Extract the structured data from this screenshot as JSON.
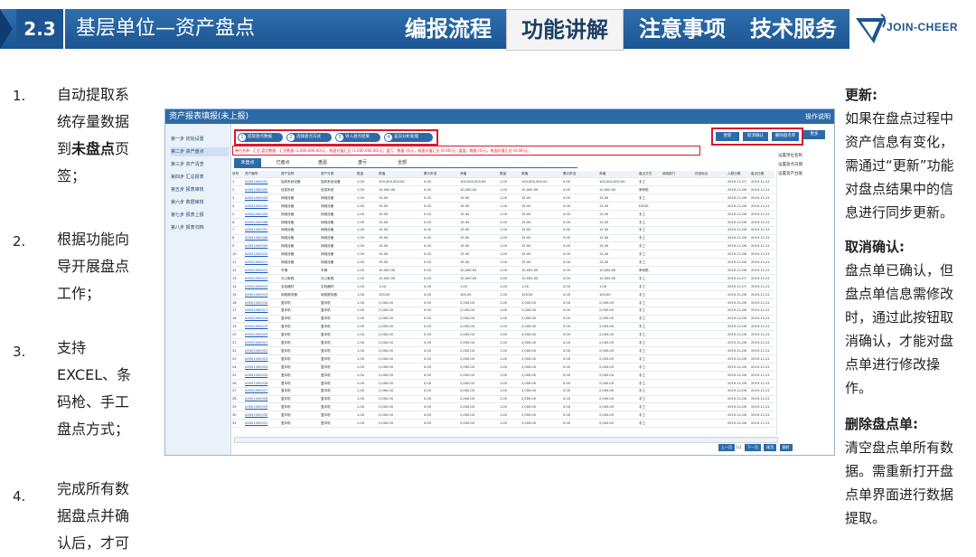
{
  "header": {
    "section_number": "2.3",
    "section_title": "基层单位—资产盘点",
    "nav": [
      "编报流程",
      "功能讲解",
      "注意事项",
      "技术服务"
    ],
    "active_nav": "功能讲解",
    "logo_text": "JOIN-CHEER"
  },
  "steps": [
    {
      "num": "1.",
      "lines": [
        "自动提取系",
        "统存量数据",
        "到|未盘点|页",
        "签；"
      ]
    },
    {
      "num": "2.",
      "lines": [
        "根据功能向",
        "导开展盘点",
        "工作；"
      ]
    },
    {
      "num": "3.",
      "lines": [
        "支持",
        "EXCEL、条",
        "码枪、手工",
        "盘点方式；"
      ]
    },
    {
      "num": "4.",
      "lines": [
        "完成所有数",
        "据盘点并确",
        "认后，才可"
      ]
    }
  ],
  "notes": [
    {
      "title": "更新:",
      "lines": [
        "如果在盘点过程中",
        "资产信息有变化，",
        "需通过“更新”功能",
        "对盘点结果中的信",
        "息进行同步更新。"
      ]
    },
    {
      "title": "取消确认:",
      "lines": [
        "盘点单已确认，但",
        "盘点单信息需修改",
        "时，通过此按钮取",
        "消确认，才能对盘",
        "点单进行修改操",
        "作。"
      ]
    },
    {
      "title": "删除盘点单:",
      "lines": [
        "清空盘点单所有数",
        "据。需重新打开盘",
        "点单界面进行数据",
        "提取。"
      ]
    }
  ],
  "screenshot": {
    "title": "资产报表填报(未上报)",
    "op_label": "操作说明",
    "sidebar": [
      "第一步 初始设置",
      "第二步 资产盘点",
      "第三步 资产清查",
      "第四步 汇总报表",
      "第五步 报表审核",
      "第六步 数据审核",
      "第七步 报表上报",
      "第八步 报表归档"
    ],
    "wizard": [
      "提取盘点数据",
      "选择盘点方式",
      "导入盘点结果",
      "差异分析处理"
    ],
    "buttons": [
      "更新",
      "取消确认",
      "删除盘点单"
    ],
    "more_label": "更多",
    "info_line": "单位名称：汇总 盘点数据：汇总数量 (1,000,000,00)元，账面价值汇总 (1,000,000,00)元；盘亏：数量 (0)元，账面价值汇总 (0.00)元；盘盈：数量 (0)元，账面价值汇总 (0.00)元；",
    "tabs": [
      "未盘点",
      "已盘点",
      "盘盈",
      "盘亏",
      "全部"
    ],
    "active_tab": "未盘点",
    "columns": [
      "序号",
      "资产编号",
      "资产名称",
      "资产分类",
      "数量",
      "原值",
      "累计折旧",
      "净值",
      "数量",
      "原值",
      "累计折旧",
      "净值",
      "盘点方式",
      "使用部门",
      "存放地点",
      "入账日期",
      "盘点日期"
    ],
    "rows": [
      [
        "1",
        "A0001000001",
        "抽风系统设备",
        "抽风系统设备",
        "1.00",
        "100,000,000.00",
        "0.00",
        "100,000,000.00",
        "1.00",
        "100,000,000.00",
        "0.00",
        "100,000,000.00",
        "手工",
        "",
        "",
        "2019-11-07",
        "2019-11-21"
      ],
      [
        "2",
        "A0001000002",
        "信息系统",
        "信息系统",
        "1.00",
        "10,000.00",
        "0.00",
        "10,000.00",
        "1.00",
        "10,000.00",
        "0.00",
        "10,000.00",
        "条码枪",
        "",
        "",
        "2019-11-06",
        "2019-11-21"
      ],
      [
        "3",
        "A0001000003",
        "网络设备",
        "网络设备",
        "1.00",
        "15.00",
        "0.00",
        "15.00",
        "1.00",
        "15.00",
        "0.00",
        "15.00",
        "手工",
        "",
        "",
        "2019-11-06",
        "2019-11-21"
      ],
      [
        "4",
        "A0001000004",
        "网络设备",
        "网络设备",
        "1.00",
        "15.00",
        "0.00",
        "15.00",
        "1.00",
        "15.00",
        "0.00",
        "15.00",
        "EXCEL",
        "",
        "",
        "2019-11-06",
        "2019-11-21"
      ],
      [
        "5",
        "A0001000005",
        "网络设备",
        "网络设备",
        "1.00",
        "15.00",
        "0.00",
        "15.00",
        "1.00",
        "15.00",
        "0.00",
        "15.00",
        "手工",
        "",
        "",
        "2019-11-06",
        "2019-11-21"
      ],
      [
        "6",
        "A0001000006",
        "网络设备",
        "网络设备",
        "1.00",
        "15.00",
        "0.00",
        "15.00",
        "1.00",
        "15.00",
        "0.00",
        "15.00",
        "手工",
        "",
        "",
        "2019-11-06",
        "2019-11-21"
      ],
      [
        "7",
        "A0001000007",
        "网络设备",
        "网络设备",
        "1.00",
        "15.00",
        "0.00",
        "15.00",
        "1.00",
        "15.00",
        "0.00",
        "15.00",
        "手工",
        "",
        "",
        "2019-11-06",
        "2019-11-21"
      ],
      [
        "8",
        "A0001000008",
        "网络设备",
        "网络设备",
        "1.00",
        "15.00",
        "0.00",
        "15.00",
        "1.00",
        "15.00",
        "0.00",
        "15.00",
        "手工",
        "",
        "",
        "2019-11-06",
        "2019-11-21"
      ],
      [
        "9",
        "A0001000009",
        "网络设备",
        "网络设备",
        "1.00",
        "15.00",
        "0.00",
        "15.00",
        "1.00",
        "15.00",
        "0.00",
        "15.00",
        "手工",
        "",
        "",
        "2019-11-06",
        "2019-11-21"
      ],
      [
        "10",
        "A0001000010",
        "网络设备",
        "网络设备",
        "1.00",
        "15.00",
        "0.00",
        "15.00",
        "1.00",
        "15.00",
        "0.00",
        "15.00",
        "手工",
        "",
        "",
        "2019-11-06",
        "2019-11-21"
      ],
      [
        "11",
        "A0001000011",
        "网络设备",
        "网络设备",
        "1.00",
        "15.00",
        "0.00",
        "15.00",
        "1.00",
        "15.00",
        "0.00",
        "15.00",
        "手工",
        "",
        "",
        "2019-11-06",
        "2019-11-21"
      ],
      [
        "12",
        "A0001000012",
        "车辆",
        "车辆",
        "1.00",
        "10,000.00",
        "0.00",
        "10,000.00",
        "1.00",
        "10,000.00",
        "0.00",
        "10,000.00",
        "条码枪",
        "",
        "",
        "2019-11-06",
        "2019-11-21"
      ],
      [
        "13",
        "A0001000013",
        "办公家具",
        "办公家具",
        "1.00",
        "10,000.00",
        "0.00",
        "10,000.00",
        "1.00",
        "10,000.00",
        "0.00",
        "10,000.00",
        "手工",
        "",
        "",
        "2019-11-07",
        "2019-11-21"
      ],
      [
        "14",
        "A0001000014",
        "实验器材",
        "实验器材",
        "1.00",
        "1.00",
        "0.00",
        "1.00",
        "1.00",
        "1.00",
        "0.00",
        "1.00",
        "手工",
        "",
        "",
        "2019-11-07",
        "2019-11-21"
      ],
      [
        "15",
        "A0001000015",
        "网络服务器",
        "网络服务器",
        "1.00",
        "100.00",
        "0.00",
        "100.00",
        "1.00",
        "100.00",
        "0.00",
        "100.00",
        "手工",
        "",
        "",
        "2019-11-06",
        "2019-11-21"
      ],
      [
        "16",
        "A0001000016",
        "复印机",
        "复印机",
        "1.00",
        "2,000.00",
        "0.00",
        "2,000.00",
        "1.00",
        "2,000.00",
        "0.00",
        "2,000.00",
        "手工",
        "",
        "",
        "2019-11-06",
        "2019-11-21"
      ],
      [
        "17",
        "A0001000017",
        "复印机",
        "复印机",
        "1.00",
        "2,000.00",
        "0.00",
        "2,000.00",
        "1.00",
        "2,000.00",
        "0.00",
        "2,000.00",
        "手工",
        "",
        "",
        "2019-11-06",
        "2019-11-21"
      ],
      [
        "18",
        "A0001000018",
        "复印机",
        "复印机",
        "1.00",
        "2,000.00",
        "0.00",
        "2,000.00",
        "1.00",
        "2,000.00",
        "0.00",
        "2,000.00",
        "手工",
        "",
        "",
        "2019-11-06",
        "2019-11-21"
      ],
      [
        "19",
        "A0001000019",
        "复印机",
        "复印机",
        "1.00",
        "2,000.00",
        "0.00",
        "2,000.00",
        "1.00",
        "2,000.00",
        "0.00",
        "2,000.00",
        "手工",
        "",
        "",
        "2019-11-06",
        "2019-11-21"
      ],
      [
        "20",
        "A0001000020",
        "复印机",
        "复印机",
        "1.00",
        "2,000.00",
        "0.00",
        "2,000.00",
        "1.00",
        "2,000.00",
        "0.00",
        "2,000.00",
        "手工",
        "",
        "",
        "2019-11-06",
        "2019-11-21"
      ],
      [
        "21",
        "A0001000021",
        "复印机",
        "复印机",
        "1.00",
        "2,000.00",
        "0.00",
        "2,000.00",
        "1.00",
        "2,000.00",
        "0.00",
        "2,000.00",
        "手工",
        "",
        "",
        "2019-11-06",
        "2019-11-21"
      ],
      [
        "22",
        "A0001000022",
        "复印机",
        "复印机",
        "1.00",
        "2,000.00",
        "0.00",
        "2,000.00",
        "1.00",
        "2,000.00",
        "0.00",
        "2,000.00",
        "手工",
        "",
        "",
        "2019-11-06",
        "2019-11-21"
      ],
      [
        "23",
        "A0001000023",
        "复印机",
        "复印机",
        "1.00",
        "2,000.00",
        "0.00",
        "2,000.00",
        "1.00",
        "2,000.00",
        "0.00",
        "2,000.00",
        "手工",
        "",
        "",
        "2019-11-06",
        "2019-11-21"
      ],
      [
        "24",
        "A0001000024",
        "复印机",
        "复印机",
        "1.00",
        "2,000.00",
        "0.00",
        "2,000.00",
        "1.00",
        "2,000.00",
        "0.00",
        "2,000.00",
        "手工",
        "",
        "",
        "2019-11-06",
        "2019-11-21"
      ],
      [
        "25",
        "A0001000025",
        "复印机",
        "复印机",
        "1.00",
        "2,000.00",
        "0.00",
        "2,000.00",
        "1.00",
        "2,000.00",
        "0.00",
        "2,000.00",
        "手工",
        "",
        "",
        "2019-11-06",
        "2019-11-21"
      ],
      [
        "26",
        "A0001000026",
        "复印机",
        "复印机",
        "1.00",
        "2,000.00",
        "0.00",
        "2,000.00",
        "1.00",
        "2,000.00",
        "0.00",
        "2,000.00",
        "手工",
        "",
        "",
        "2019-11-06",
        "2019-11-21"
      ],
      [
        "27",
        "A0001000027",
        "复印机",
        "复印机",
        "1.00",
        "2,000.00",
        "0.00",
        "2,000.00",
        "1.00",
        "2,000.00",
        "0.00",
        "2,000.00",
        "手工",
        "",
        "",
        "2019-11-06",
        "2019-11-21"
      ],
      [
        "28",
        "A0001000028",
        "复印机",
        "复印机",
        "1.00",
        "2,000.00",
        "0.00",
        "2,000.00",
        "1.00",
        "2,000.00",
        "0.00",
        "2,000.00",
        "手工",
        "",
        "",
        "2019-11-06",
        "2019-11-21"
      ],
      [
        "29",
        "A0001000029",
        "复印机",
        "复印机",
        "1.00",
        "2,000.00",
        "0.00",
        "2,000.00",
        "1.00",
        "2,000.00",
        "0.00",
        "2,000.00",
        "手工",
        "",
        "",
        "2019-11-06",
        "2019-11-21"
      ],
      [
        "30",
        "A0001000030",
        "复印机",
        "复印机",
        "1.00",
        "2,000.00",
        "0.00",
        "2,000.00",
        "1.00",
        "2,000.00",
        "0.00",
        "2,000.00",
        "手工",
        "",
        "",
        "2019-11-06",
        "2019-11-21"
      ],
      [
        "31",
        "A0001000031",
        "复印机",
        "复印机",
        "1.00",
        "2,000.00",
        "0.00",
        "2,000.00",
        "1.00",
        "2,000.00",
        "0.00",
        "2,000.00",
        "手工",
        "",
        "",
        "2019-11-06",
        "2019-11-21"
      ]
    ],
    "right_notes": [
      "设置单位名称",
      "设置盘点日期",
      "设置资产台账"
    ],
    "pager": {
      "prev": "上一页",
      "page": "1/2",
      "next": "下一页",
      "last": "尾页",
      "go": "跳转"
    }
  }
}
